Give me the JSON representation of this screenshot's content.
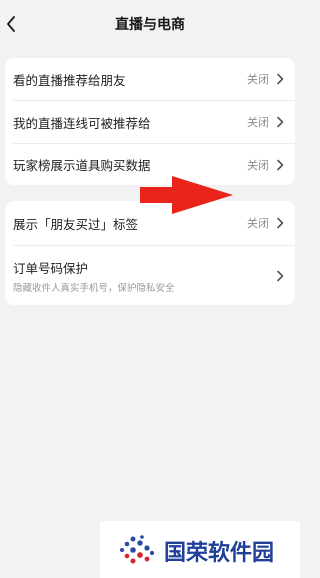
{
  "header": {
    "title": "直播与电商"
  },
  "section1": {
    "rows": [
      {
        "label": "看的直播推荐给朋友",
        "value": "关闭"
      },
      {
        "label": "我的直播连线可被推荐给",
        "value": "关闭"
      },
      {
        "label": "玩家榜展示道具购买数据",
        "value": "关闭"
      }
    ]
  },
  "section2": {
    "rows": [
      {
        "label": "展示「朋友买过」标签",
        "value": "关闭"
      },
      {
        "label": "订单号码保护",
        "subtitle": "隐藏收件人真实手机号，保护隐私安全"
      }
    ]
  },
  "annotation": {
    "arrow_color": "#e8241d"
  },
  "watermark": {
    "text": "国荣软件园"
  }
}
